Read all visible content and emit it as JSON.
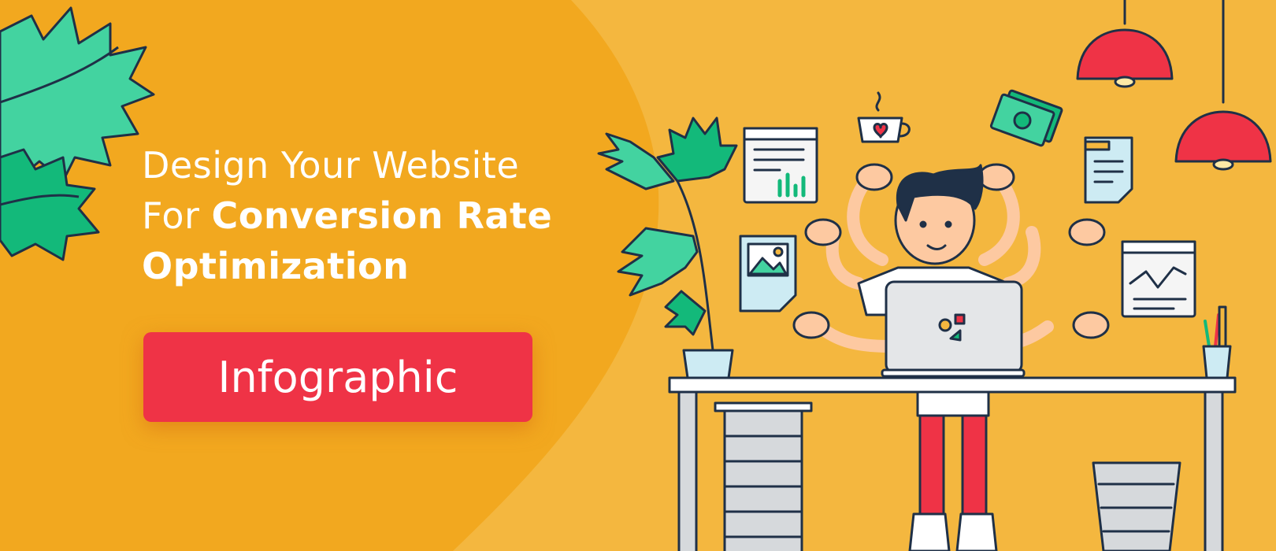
{
  "headline": {
    "line1": "Design Your Website",
    "line2_prefix": "For ",
    "line2_bold": "Conversion Rate",
    "line3_bold": "Optimization"
  },
  "cta": {
    "label": "Infographic"
  },
  "colors": {
    "background": "#F4B73F",
    "blob": "#F2A81F",
    "cta": "#EF3346",
    "leaf": "#43D3A0",
    "leaf_dark": "#13B97A",
    "outline": "#1F3047",
    "lamp": "#EF3346"
  },
  "icons": [
    "leaf-icon",
    "plant-icon",
    "coffee-cup-icon",
    "money-icon",
    "document-icon",
    "image-icon",
    "line-chart-icon",
    "lamp-icon",
    "laptop-icon",
    "pencil-cup-icon",
    "trash-bin-icon"
  ]
}
